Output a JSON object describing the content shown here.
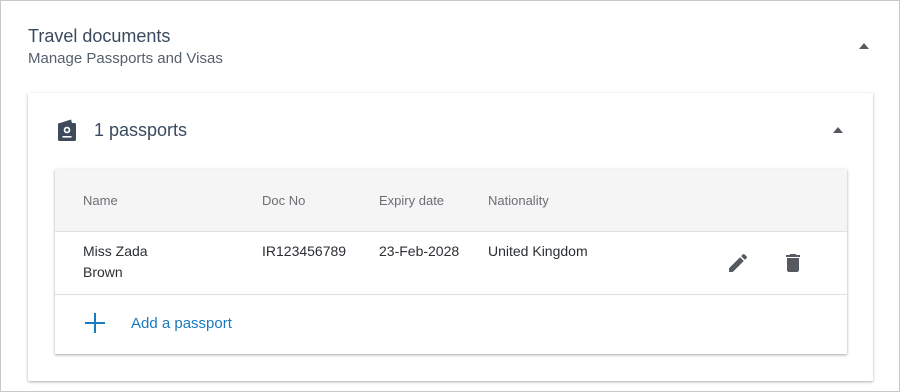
{
  "section": {
    "title": "Travel documents",
    "subtitle": "Manage Passports and Visas"
  },
  "passports": {
    "title": "1 passports",
    "columns": {
      "name": "Name",
      "doc_no": "Doc No",
      "expiry": "Expiry date",
      "nationality": "Nationality"
    },
    "rows": [
      {
        "name_line1": "Miss Zada",
        "name_line2": "Brown",
        "doc_no": "IR123456789",
        "expiry": "23-Feb-2028",
        "nationality": "United Kingdom"
      }
    ],
    "add_label": "Add a passport"
  },
  "icons": {
    "collapse": "chevron-up-icon",
    "passport": "passport-icon",
    "edit": "pencil-icon",
    "delete": "trash-icon",
    "add": "plus-icon"
  },
  "colors": {
    "title_text": "#3a4a5e",
    "link_blue": "#1a7ac0",
    "header_bg": "#f5f5f5",
    "icon_gray": "#555a60"
  }
}
